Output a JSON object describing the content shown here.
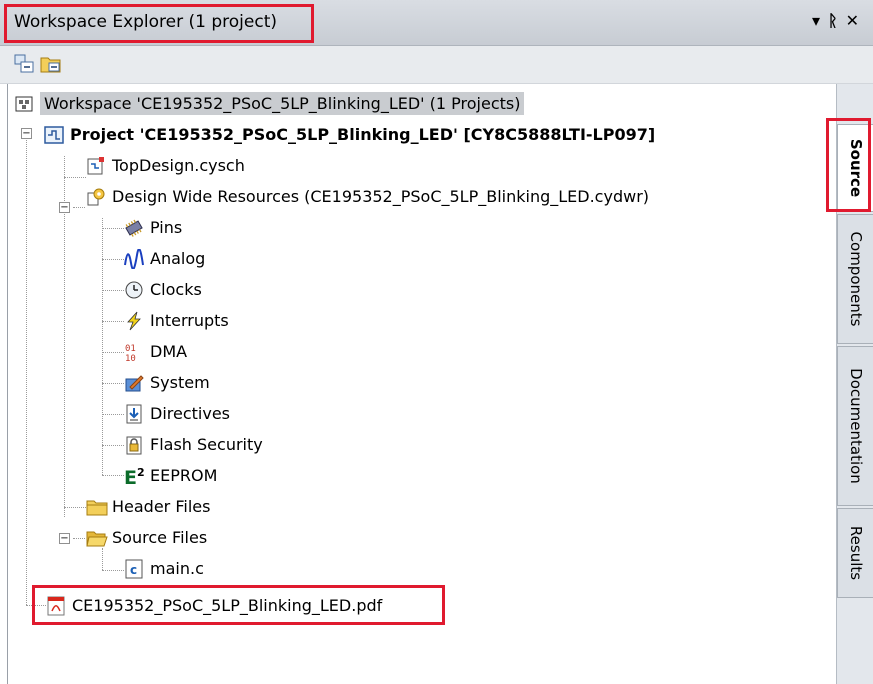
{
  "window": {
    "title": "Workspace Explorer (1 project)",
    "controls": [
      "▾",
      "ᚱ",
      "✕"
    ]
  },
  "toolbar": {
    "buttons": [
      "collapse-all-icon",
      "open-folder-icon"
    ]
  },
  "tree": {
    "workspace": "Workspace 'CE195352_PSoC_5LP_Blinking_LED' (1 Projects)",
    "project": "Project  'CE195352_PSoC_5LP_Blinking_LED' [CY8C5888LTI-LP097]",
    "topdesign": "TopDesign.cysch",
    "dwr": "Design Wide Resources (CE195352_PSoC_5LP_Blinking_LED.cydwr)",
    "dwr_items": [
      "Pins",
      "Analog",
      "Clocks",
      "Interrupts",
      "DMA",
      "System",
      "Directives",
      "Flash Security",
      "EEPROM"
    ],
    "header_files": "Header Files",
    "source_files": "Source Files",
    "main_c": "main.c",
    "pdf": "CE195352_PSoC_5LP_Blinking_LED.pdf"
  },
  "tabs": [
    "Source",
    "Components",
    "Documentation",
    "Results"
  ],
  "colors": {
    "highlight": "#e01a2f",
    "selection": "#c9ccd0"
  }
}
